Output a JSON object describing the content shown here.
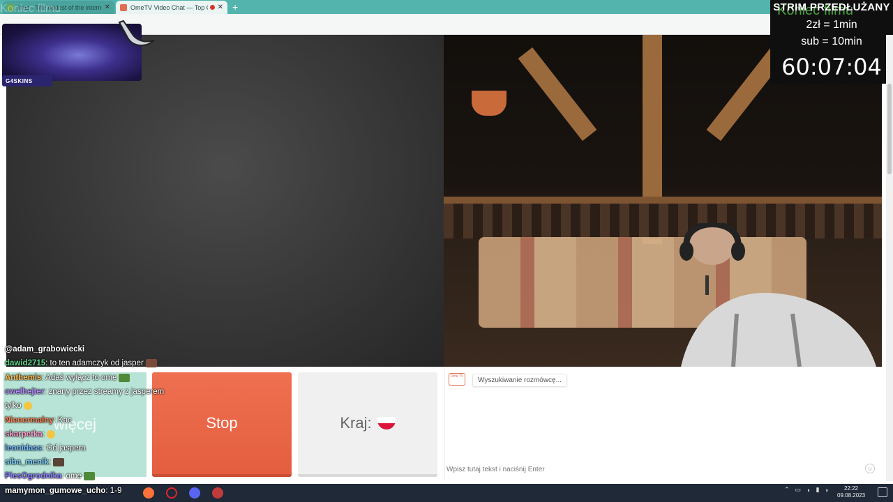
{
  "browser": {
    "tabs": [
      {
        "label": "Inne - The oddest of the internet",
        "fav_color": "#6aa84f"
      },
      {
        "label": "OmeTV Video Chat — Top C...",
        "fav_color": "#e26e4f"
      }
    ],
    "new_tab_icon": "plus-icon"
  },
  "overlay_dim_text": "Koniec filmu",
  "subathon": {
    "title": "STRIM PRZEDŁUŻANY",
    "ghost": "Koniec filmu",
    "rate1": "2zł = 1min",
    "rate2": "sub = 10min",
    "timer": "60:07:04"
  },
  "webcam": {
    "label": "G4SKINS"
  },
  "ome": {
    "stop_label": "Stop",
    "country_label": "Kraj:",
    "more_label": "więcej",
    "status_text": "Wyszukiwanie rozmówcę...",
    "logo_text": "Ome TV",
    "input_placeholder": "Wpisz tutaj tekst i naciśnij Enter"
  },
  "stream_chat": [
    {
      "user": "@adam_grabowiecki",
      "text": "",
      "color": "#ffffff"
    },
    {
      "user": "dawid2715",
      "text": ": to ten adamczyk od jasper",
      "color": "#5fd38a"
    },
    {
      "user": "Anthemis",
      "text": ": Adaś wyłącz to ome",
      "color": "#ffb84d"
    },
    {
      "user": "cwelhejter",
      "text": ": znany przez streamy z jasperem",
      "color": "#b48cff"
    },
    {
      "user": "",
      "text": "tylko",
      "color": "#ffffff"
    },
    {
      "user": "Nienormalny",
      "text": ": Kac",
      "color": "#ff7f50"
    },
    {
      "user": "skarpetka",
      "text": ":",
      "color": "#ff9ecb"
    },
    {
      "user": "leonidass",
      "text": ": Od jaspera",
      "color": "#6fb6ff"
    },
    {
      "user": "siba_menik",
      "text": ":",
      "color": "#7fd3ff"
    },
    {
      "user": "PiesOgrodnika",
      "text": ": ome",
      "color": "#8a7dff"
    },
    {
      "user": "mamymon_gumowe_ucho",
      "text": ": 1-9",
      "color": "#ffffff"
    }
  ],
  "taskbar": {
    "clock_time": "22:22",
    "clock_date": "09.08.2023"
  }
}
